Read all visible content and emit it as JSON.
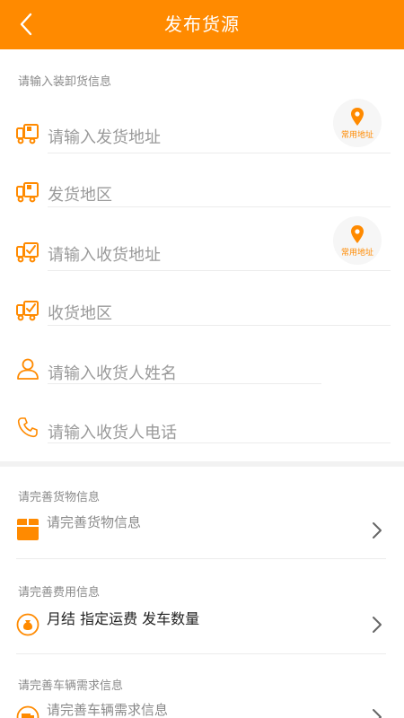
{
  "header": {
    "title": "发布货源"
  },
  "loading": {
    "hint": "请输入装卸货信息",
    "fav_label": "常用地址",
    "rows": [
      {
        "label": "请输入发货地址",
        "icon": "truck-box-icon"
      },
      {
        "label": "发货地区",
        "icon": "truck-box-icon"
      },
      {
        "label": "请输入收货地址",
        "icon": "truck-check-icon"
      },
      {
        "label": "收货地区",
        "icon": "truck-check-icon"
      },
      {
        "label": "请输入收货人姓名",
        "icon": "person-icon"
      },
      {
        "label": "请输入收货人电话",
        "icon": "phone-icon"
      }
    ]
  },
  "cargo": {
    "hint": "请完善货物信息",
    "label": "请完善货物信息"
  },
  "fees": {
    "hint": "请完善费用信息",
    "label": "月结 指定运费 发车数量"
  },
  "vehicle": {
    "hint": "请完善车辆需求信息",
    "label": "请完善车辆需求信息"
  },
  "colors": {
    "accent": "#ff8a00",
    "hint_text": "#8a8a8a",
    "divider": "#ececec"
  }
}
